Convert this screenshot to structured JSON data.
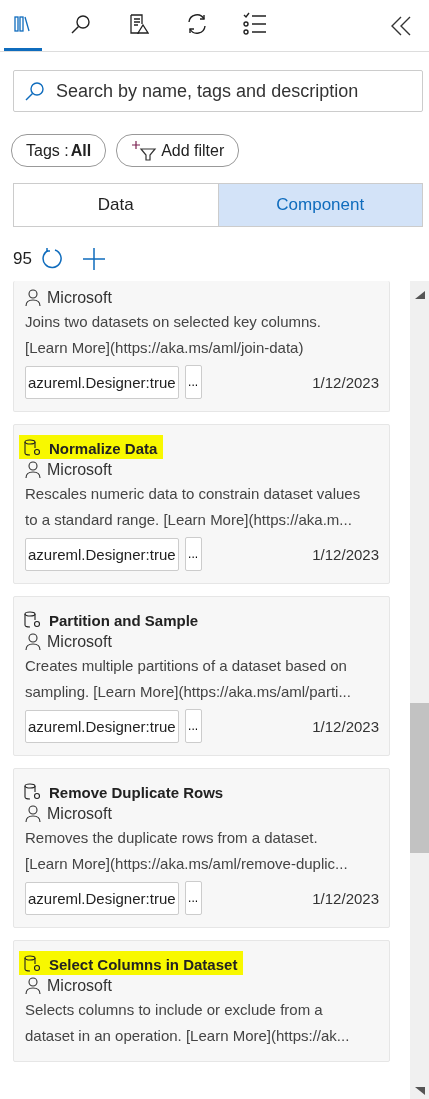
{
  "toolbar": {
    "tabs": [
      {
        "kind": "library",
        "selected": true
      },
      {
        "kind": "search",
        "selected": false
      },
      {
        "kind": "document",
        "selected": false
      },
      {
        "kind": "refresh",
        "selected": false
      },
      {
        "kind": "checklist",
        "selected": false
      }
    ]
  },
  "search": {
    "placeholder": "Search by name, tags and description"
  },
  "filters": {
    "tags_label": "Tags : ",
    "tags_value": "All",
    "add_filter": "Add filter"
  },
  "segments": [
    {
      "label": "Data",
      "selected": false
    },
    {
      "label": "Component",
      "selected": true
    }
  ],
  "count": "95",
  "cards": [
    {
      "author": "Microsoft",
      "description": [
        "Joins two datasets on selected key columns.",
        "[Learn More](https://aka.ms/aml/join-data)"
      ],
      "tag": "azureml.Designer:true",
      "more": "...",
      "date": "1/12/2023"
    },
    {
      "title": "Normalize Data",
      "highlighted": true,
      "author": "Microsoft",
      "description": [
        "Rescales numeric data to constrain dataset values",
        "to a standard range. [Learn More](https://aka.m..."
      ],
      "tag": "azureml.Designer:true",
      "more": "...",
      "date": "1/12/2023"
    },
    {
      "title": "Partition and Sample",
      "highlighted": false,
      "author": "Microsoft",
      "description": [
        "Creates multiple partitions of a dataset based on",
        "sampling. [Learn More](https://aka.ms/aml/parti..."
      ],
      "tag": "azureml.Designer:true",
      "more": "...",
      "date": "1/12/2023"
    },
    {
      "title": "Remove Duplicate Rows",
      "highlighted": false,
      "author": "Microsoft",
      "description": [
        "Removes the duplicate rows from a dataset.",
        "[Learn More](https://aka.ms/aml/remove-duplic..."
      ],
      "tag": "azureml.Designer:true",
      "more": "...",
      "date": "1/12/2023"
    },
    {
      "title": "Select Columns in Dataset",
      "highlighted": true,
      "author": "Microsoft",
      "description": [
        "Selects columns to include or exclude from a",
        "dataset in an operation. [Learn More](https://ak..."
      ]
    }
  ]
}
